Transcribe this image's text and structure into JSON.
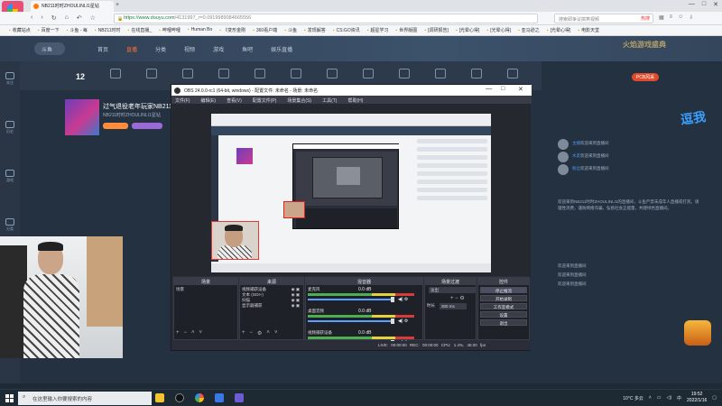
{
  "browser": {
    "logo_label": "恢复隐藏",
    "tab_title": "NB211时时ZHOULINLI1星钻",
    "url_host": "https://www.douyu.com",
    "url_path": "/4131997_r=0.0919989084665556",
    "search_placeholder": "搜索即争议搞笑视频",
    "search_hot": "热搜",
    "bookmarks": [
      "收藏站点",
      "百度一下",
      "斗鱼 - 每",
      "NB211时时",
      "在线直播_",
      "哔哩哔哩",
      "Human Bo",
      "《变形金刚",
      "360看户端",
      "斗鱼",
      "发现解答",
      "CS:GO资讯",
      "超星学习",
      "世界版图",
      "[调研报告]",
      "[光晕心得]",
      "[光晕心得]",
      "亚马逊之",
      "[光晕心得]",
      "电影天堂"
    ]
  },
  "douyu": {
    "logo": "斗鱼",
    "menu": [
      "首页",
      "直播",
      "分类",
      "视频",
      "游戏",
      "鱼吧",
      "娱乐直播"
    ],
    "active_menu": "直播",
    "banner": "火焰游戏盛典",
    "level_num": "12",
    "pk_badge": "PCB风采",
    "anchor_title": "过气退役老年玩家NB211的...",
    "anchor_sub": "NB211时时ZHOULINLI1星钻",
    "side_items": [
      "关注",
      "历史",
      "游戏",
      "分类",
      "视频",
      "鱼吧"
    ],
    "big_text": "逗我",
    "chat_lines": [
      "欢迎来到直播间",
      "欢迎来到直播间",
      "欢迎来到直播间"
    ],
    "chat_names": [
      "主播",
      "水友",
      "粉丝"
    ],
    "chat_paragraph": "欢迎来到NB211时时ZHOULINLI1的直播间，斗鱼严禁未成年人直播或打赏。请理性消费，谨防网络诈骗，弘扬社会正能量，共建绿色直播间。"
  },
  "obs": {
    "title": "OBS 24.0.0-rc1 (64-bit, windows) - 配置文件: 未命名 - 场景: 未命名",
    "menu": [
      "文件(F)",
      "编辑(E)",
      "查看(V)",
      "配置文件(P)",
      "场景集合(S)",
      "工具(T)",
      "帮助(H)"
    ],
    "docks": {
      "scenes": {
        "header": "场景",
        "items": [
          "场景"
        ]
      },
      "sources": {
        "header": "来源",
        "items": [
          "视频捕获设备",
          "文本 (GDI+)",
          "扫描",
          "显示器捕获"
        ]
      },
      "mixer": {
        "header": "混音器",
        "channels": [
          {
            "name": "麦克风",
            "vol": "0.0 dB"
          },
          {
            "name": "桌面音频",
            "vol": "0.0 dB"
          },
          {
            "name": "视频捕获设备",
            "vol": "0.0 dB"
          }
        ]
      },
      "transitions": {
        "header": "场景过渡",
        "selected": "淡出",
        "duration_label": "时长",
        "duration_value": "300 ms"
      },
      "controls": {
        "header": "控件",
        "buttons": [
          "停止推流",
          "开始录制",
          "工作室模式",
          "设置",
          "退出"
        ]
      }
    },
    "status": "LIVE: 00:00:00   REC: 00:00:00   CPU: 1.4%, 48.00 fps"
  },
  "taskbar": {
    "search_placeholder": "在这里输入你要搜索的内容",
    "weather": "10°C 多云",
    "ime": "中",
    "time": "19:52",
    "date": "2022/1/16"
  }
}
